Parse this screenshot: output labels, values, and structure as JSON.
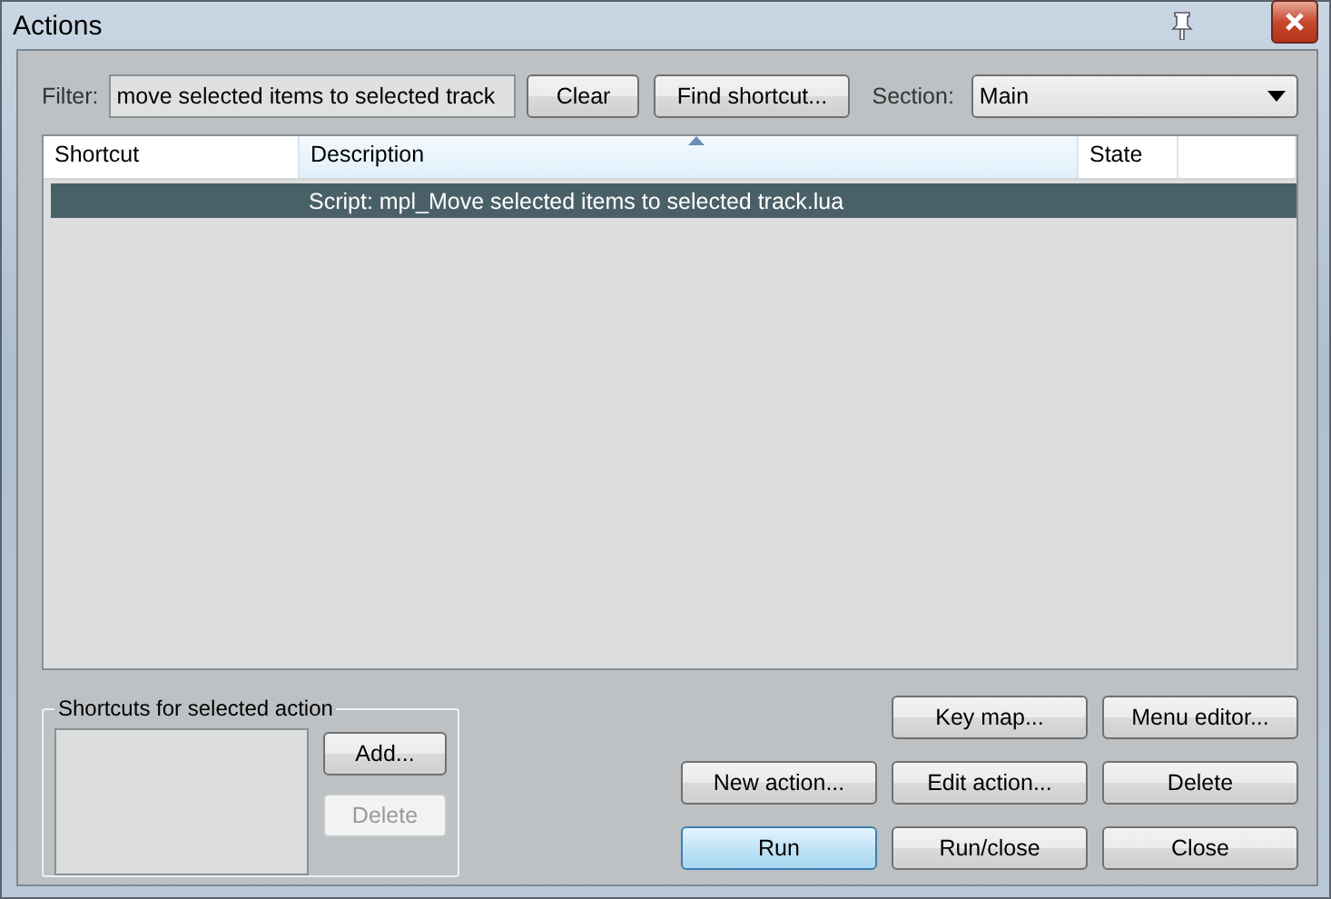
{
  "window": {
    "title": "Actions"
  },
  "filter": {
    "label": "Filter:",
    "value": "move selected items to selected track"
  },
  "toolbar_buttons": [
    {
      "label": "Clear"
    },
    {
      "label": "Find shortcut..."
    }
  ],
  "section": {
    "label": "Section:",
    "value": "Main"
  },
  "table": {
    "columns": [
      {
        "label": "Shortcut",
        "sorted": false
      },
      {
        "label": "Description",
        "sorted": true
      },
      {
        "label": "State",
        "sorted": false
      }
    ],
    "rows": [
      {
        "shortcut": "",
        "description": "Script: mpl_Move selected items to selected track.lua",
        "state": "",
        "selected": true
      }
    ]
  },
  "shortcuts_group": {
    "title": "Shortcuts for selected action",
    "buttons": [
      {
        "label": "Add...",
        "disabled": false
      },
      {
        "label": "Delete",
        "disabled": true
      }
    ]
  },
  "action_buttons": [
    {
      "label": "Key map...",
      "default": false
    },
    {
      "label": "Menu editor...",
      "default": false
    },
    {
      "label": "New action...",
      "default": false
    },
    {
      "label": "Edit action...",
      "default": false
    },
    {
      "label": "Delete",
      "default": false
    },
    {
      "label": "Run",
      "default": true
    },
    {
      "label": "Run/close",
      "default": false
    },
    {
      "label": "Close",
      "default": false
    }
  ]
}
